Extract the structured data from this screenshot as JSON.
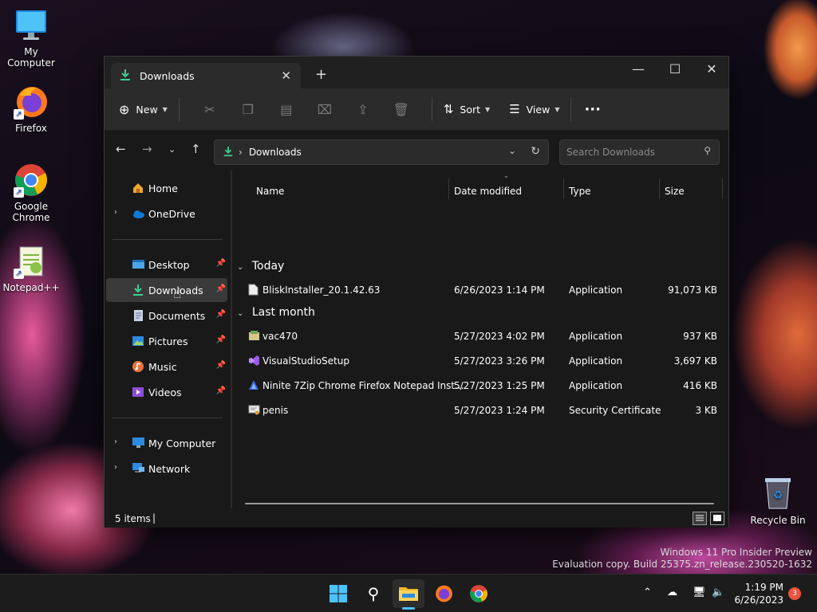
{
  "desktop": {
    "icons": [
      {
        "label": "My Computer"
      },
      {
        "label": "Firefox"
      },
      {
        "label": "Google Chrome"
      },
      {
        "label": "Notepad++"
      }
    ],
    "recycle_bin": "Recycle Bin",
    "watermark_line1": "Windows 11 Pro Insider Preview",
    "watermark_line2": "Evaluation copy. Build 25375.zn_release.230520-1632"
  },
  "window": {
    "tab_title": "Downloads",
    "toolbar": {
      "new_label": "New",
      "sort_label": "Sort",
      "view_label": "View",
      "more_label": "···"
    },
    "address": {
      "breadcrumb": "Downloads",
      "search_placeholder": "Search Downloads"
    },
    "sidebar": {
      "home": "Home",
      "onedrive": "OneDrive",
      "pinned": [
        {
          "label": "Desktop"
        },
        {
          "label": "Downloads"
        },
        {
          "label": "Documents"
        },
        {
          "label": "Pictures"
        },
        {
          "label": "Music"
        },
        {
          "label": "Videos"
        }
      ],
      "my_computer": "My Computer",
      "network": "Network"
    },
    "columns": {
      "name": "Name",
      "date": "Date modified",
      "type": "Type",
      "size": "Size"
    },
    "groups": [
      {
        "label": "Today",
        "files": [
          {
            "name": "BliskInstaller_20.1.42.63",
            "date": "6/26/2023 1:14 PM",
            "type": "Application",
            "size": "91,073 KB"
          }
        ]
      },
      {
        "label": "Last month",
        "files": [
          {
            "name": "vac470",
            "date": "5/27/2023 4:02 PM",
            "type": "Application",
            "size": "937 KB"
          },
          {
            "name": "VisualStudioSetup",
            "date": "5/27/2023 3:26 PM",
            "type": "Application",
            "size": "3,697 KB"
          },
          {
            "name": "Ninite 7Zip Chrome Firefox Notepad Inst...",
            "date": "5/27/2023 1:25 PM",
            "type": "Application",
            "size": "416 KB"
          },
          {
            "name": "penis",
            "date": "5/27/2023 1:24 PM",
            "type": "Security Certificate",
            "size": "3 KB"
          }
        ]
      }
    ],
    "status": {
      "items": "5 items",
      "cursor": "|"
    }
  },
  "taskbar": {
    "time": "1:19 PM",
    "date": "6/26/2023",
    "notifications": "3"
  },
  "colors": {
    "accent": "#0078d4",
    "download_green": "#3ccf91",
    "selected_bg": "#3a3a3a"
  }
}
